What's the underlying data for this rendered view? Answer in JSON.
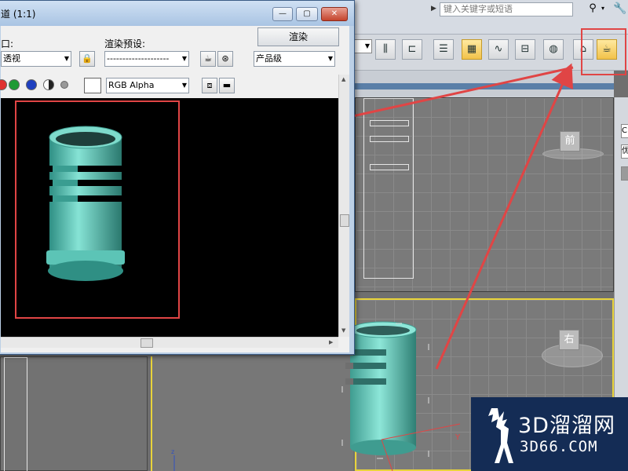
{
  "search": {
    "placeholder": "键入关键字或短语"
  },
  "render_window": {
    "title": "道 (1:1)",
    "viewport_label": "口:",
    "viewport_value": "透视",
    "preset_label": "渲染预设:",
    "preset_value": "--------------------",
    "render_button": "渲染",
    "production_value": "产品级",
    "channel_value": "RGB Alpha"
  },
  "viewcube": {
    "front": "前",
    "right": "右"
  },
  "command_panel": {
    "c": "C",
    "h": "优"
  },
  "watermark": {
    "title": "3D溜溜网",
    "subtitle": "3D66.COM"
  },
  "colors": {
    "highlight": "#e04545",
    "object": "#6fd4c4",
    "active_viewport": "#e8d33a",
    "watermark_bg": "#142c55"
  }
}
